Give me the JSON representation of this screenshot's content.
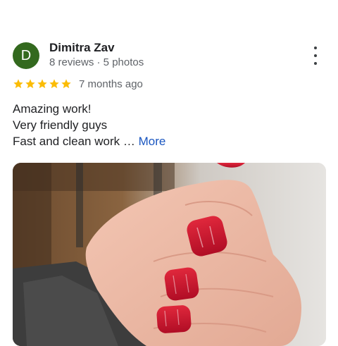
{
  "review": {
    "author": {
      "initial": "D",
      "name": "Dimitra Zav",
      "stats": "8 reviews · 5 photos",
      "avatar_color": "#33691e"
    },
    "rating": 5,
    "star_color": "#fbbc04",
    "time_ago": "7 months ago",
    "text_lines": [
      "Amazing work!",
      "Very friendly guys",
      "Fast and clean work"
    ],
    "ellipsis": "…",
    "more_label": "More",
    "menu_icon": "more-vertical-icon",
    "photo": {
      "subject": "hand with red manicured nails",
      "nail_color": "#c8102e"
    }
  }
}
